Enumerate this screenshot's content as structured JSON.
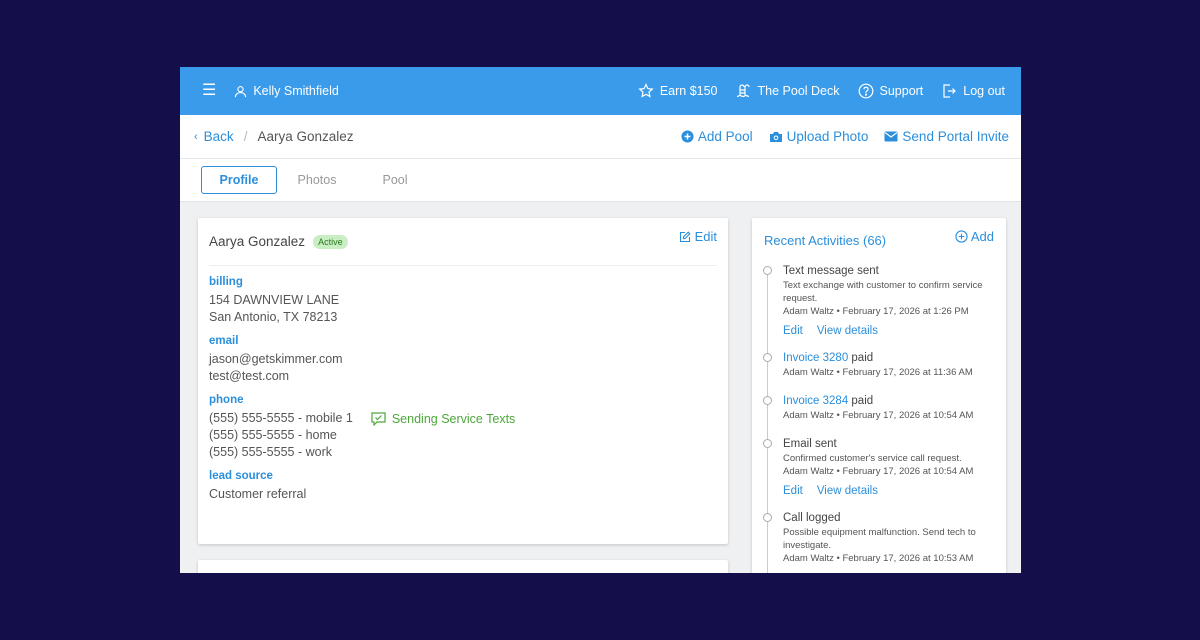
{
  "topbar": {
    "menu_icon": "hamburger-icon",
    "user_name": "Kelly Smithfield",
    "earn": "Earn $150",
    "pool_deck": "The Pool Deck",
    "support": "Support",
    "logout": "Log out"
  },
  "breadcrumb": {
    "back": "Back",
    "separator": "/",
    "current": "Aarya Gonzalez"
  },
  "actions": {
    "add_pool": "Add Pool",
    "upload_photo": "Upload Photo",
    "send_invite": "Send Portal Invite"
  },
  "tabs": [
    {
      "label": "Profile",
      "active": true
    },
    {
      "label": "Photos",
      "active": false
    },
    {
      "label": "Pool",
      "active": false
    }
  ],
  "profile": {
    "name": "Aarya Gonzalez",
    "status": "Active",
    "edit_label": "Edit",
    "billing_label": "billing",
    "billing_lines": [
      "154 DAWNVIEW LANE",
      "San Antonio, TX 78213"
    ],
    "email_label": "email",
    "emails": [
      "jason@getskimmer.com",
      "test@test.com"
    ],
    "phone_label": "phone",
    "phones": [
      "(555) 555-5555 - mobile 1",
      "(555) 555-5555 - home",
      "(555) 555-5555 - work"
    ],
    "sending_texts": "Sending Service Texts",
    "lead_label": "lead source",
    "lead_value": "Customer referral"
  },
  "activities": {
    "title": "Recent Activities (66)",
    "add_label": "Add",
    "items": [
      {
        "title": "Text message sent",
        "link": "",
        "suffix": "",
        "desc": "Text exchange with customer to confirm service request.",
        "meta": "Adam Waltz • February 17, 2026 at 1:26 PM",
        "edit": "Edit",
        "view": "View details"
      },
      {
        "title": "",
        "link": "Invoice 3280",
        "suffix": " paid",
        "desc": "",
        "meta": "Adam Waltz • February 17, 2026 at 11:36 AM",
        "edit": "",
        "view": ""
      },
      {
        "title": "",
        "link": "Invoice 3284",
        "suffix": " paid",
        "desc": "",
        "meta": "Adam Waltz • February 17, 2026 at 10:54 AM",
        "edit": "",
        "view": ""
      },
      {
        "title": "Email sent",
        "link": "",
        "suffix": "",
        "desc": "Confirmed customer's service call request.",
        "meta": "Adam Waltz • February 17, 2026 at 10:54 AM",
        "edit": "Edit",
        "view": "View details"
      },
      {
        "title": "Call logged",
        "link": "",
        "suffix": "",
        "desc": "Possible equipment malfunction. Send tech to investigate.",
        "meta": "Adam Waltz • February 17, 2026 at 10:53 AM",
        "edit": "",
        "view": ""
      }
    ]
  },
  "colors": {
    "topbar": "#3a9bea",
    "accent": "#2b8fdc",
    "background": "#140f4b",
    "success": "#4da83a",
    "badge_bg": "#c9eec3"
  }
}
